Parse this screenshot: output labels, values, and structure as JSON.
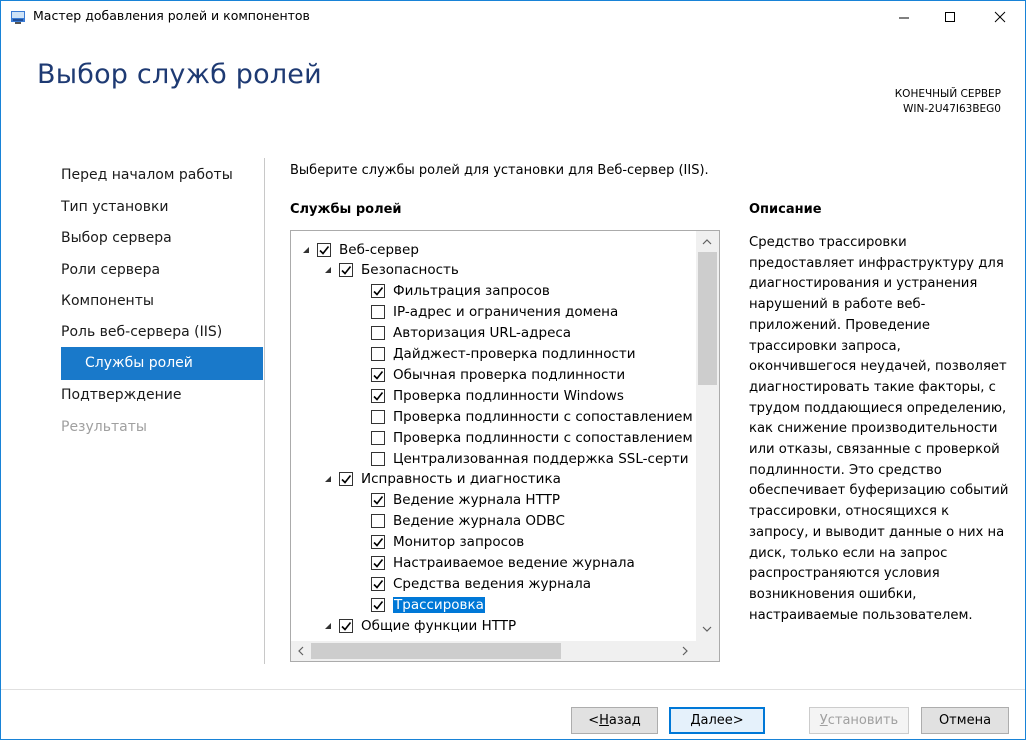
{
  "window": {
    "title": "Мастер добавления ролей и компонентов"
  },
  "header": {
    "page_title": "Выбор служб ролей",
    "server_caption": "КОНЕЧНЫЙ СЕРВЕР",
    "server_name": "WIN-2U47I63BEG0"
  },
  "nav": {
    "items": [
      {
        "label": "Перед началом работы",
        "state": "normal"
      },
      {
        "label": "Тип установки",
        "state": "normal"
      },
      {
        "label": "Выбор сервера",
        "state": "normal"
      },
      {
        "label": "Роли сервера",
        "state": "normal"
      },
      {
        "label": "Компоненты",
        "state": "normal"
      },
      {
        "label": "Роль веб-сервера (IIS)",
        "state": "normal"
      },
      {
        "label": "Службы ролей",
        "state": "selected"
      },
      {
        "label": "Подтверждение",
        "state": "normal"
      },
      {
        "label": "Результаты",
        "state": "disabled"
      }
    ]
  },
  "main": {
    "instruction": "Выберите службы ролей для установки для Веб-сервер (IIS).",
    "role_services_label": "Службы ролей",
    "description_label": "Описание",
    "description": "Средство трассировки предоставляет инфраструктуру для диагностирования и устранения нарушений в работе веб-приложений. Проведение трассировки запроса, окончившегося неудачей, позволяет диагностировать такие факторы, с трудом поддающиеся определению, как снижение производительности или отказы, связанные с проверкой подлинности. Это средство обеспечивает буферизацию событий трассировки, относящихся к запросу, и выводит данные о них на диск, только если на запрос распространяются условия возникновения ошибки, настраиваемые пользователем."
  },
  "tree": [
    {
      "label": "Веб-сервер",
      "level": 0,
      "expander": true,
      "checked": true
    },
    {
      "label": "Безопасность",
      "level": 1,
      "expander": true,
      "checked": true
    },
    {
      "label": "Фильтрация запросов",
      "level": 2,
      "expander": false,
      "checked": true
    },
    {
      "label": "IP-адрес и ограничения домена",
      "level": 2,
      "expander": false,
      "checked": false
    },
    {
      "label": "Авторизация URL-адреса",
      "level": 2,
      "expander": false,
      "checked": false
    },
    {
      "label": "Дайджест-проверка подлинности",
      "level": 2,
      "expander": false,
      "checked": false
    },
    {
      "label": "Обычная проверка подлинности",
      "level": 2,
      "expander": false,
      "checked": true
    },
    {
      "label": "Проверка подлинности Windows",
      "level": 2,
      "expander": false,
      "checked": true
    },
    {
      "label": "Проверка подлинности с сопоставлением",
      "level": 2,
      "expander": false,
      "checked": false
    },
    {
      "label": "Проверка подлинности с сопоставлением",
      "level": 2,
      "expander": false,
      "checked": false
    },
    {
      "label": "Централизованная поддержка SSL-серти",
      "level": 2,
      "expander": false,
      "checked": false
    },
    {
      "label": "Исправность и диагностика",
      "level": 1,
      "expander": true,
      "checked": true
    },
    {
      "label": "Ведение журнала HTTP",
      "level": 2,
      "expander": false,
      "checked": true
    },
    {
      "label": "Ведение журнала ODBC",
      "level": 2,
      "expander": false,
      "checked": false
    },
    {
      "label": "Монитор запросов",
      "level": 2,
      "expander": false,
      "checked": true
    },
    {
      "label": "Настраиваемое ведение журнала",
      "level": 2,
      "expander": false,
      "checked": true
    },
    {
      "label": "Средства ведения журнала",
      "level": 2,
      "expander": false,
      "checked": true
    },
    {
      "label": "Трассировка",
      "level": 2,
      "expander": false,
      "checked": true,
      "highlighted": true
    },
    {
      "label": "Общие функции HTTP",
      "level": 1,
      "expander": true,
      "checked": true
    }
  ],
  "buttons": {
    "back": {
      "label_u": "Н",
      "label_rest": "азад",
      "prefix": "< "
    },
    "next": {
      "label_u": "Д",
      "label_rest": "алее",
      "suffix": " >"
    },
    "install": {
      "label_u": "У",
      "label_rest": "становить"
    },
    "cancel": {
      "label": "Отмена"
    }
  },
  "colors": {
    "accent": "#1979ca",
    "title": "#1e3a73",
    "highlight": "#0078d7"
  }
}
